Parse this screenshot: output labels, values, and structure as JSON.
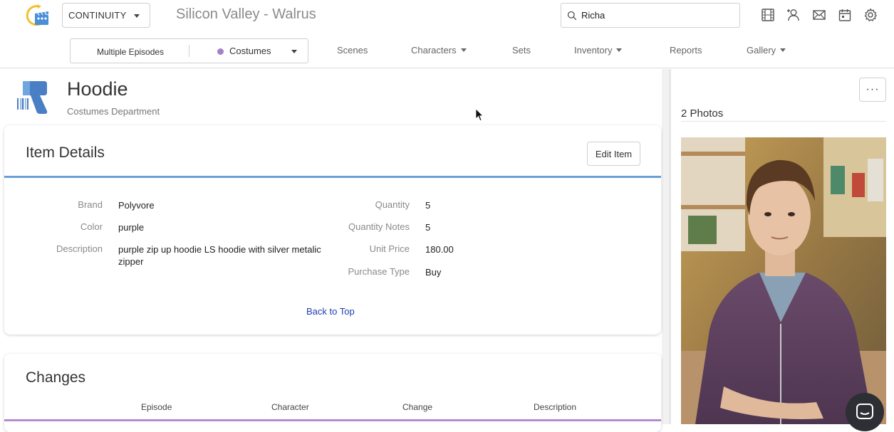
{
  "app": {
    "selector_label": "CONTINUITY",
    "project_title": "Silicon Valley - Walrus"
  },
  "search": {
    "value": "Richa"
  },
  "toolbar_icons": [
    "film-icon",
    "add-user-icon",
    "mail-icon",
    "calendar-icon",
    "settings-icon"
  ],
  "filter": {
    "episodes_label": "Multiple Episodes",
    "department_label": "Costumes",
    "department_color": "#a57fc7"
  },
  "nav": {
    "scenes": "Scenes",
    "characters": "Characters",
    "sets": "Sets",
    "inventory": "Inventory",
    "reports": "Reports",
    "gallery": "Gallery"
  },
  "item": {
    "title": "Hoodie",
    "department": "Costumes Department"
  },
  "details": {
    "title": "Item Details",
    "edit_label": "Edit Item",
    "left_fields": [
      {
        "label": "Brand",
        "value": "Polyvore"
      },
      {
        "label": "Color",
        "value": "purple"
      },
      {
        "label": "Description",
        "value": "purple zip up hoodie LS hoodie with silver metalic zipper"
      }
    ],
    "right_fields": [
      {
        "label": "Quantity",
        "value": "5"
      },
      {
        "label": "Quantity Notes",
        "value": "5"
      },
      {
        "label": "Unit Price",
        "value": "180.00"
      },
      {
        "label": "Purchase Type",
        "value": "Buy"
      }
    ],
    "back_to_top": "Back to Top",
    "accent_color": "#6a9fd6"
  },
  "changes": {
    "title": "Changes",
    "columns": [
      "Episode",
      "Character",
      "Change",
      "Description"
    ],
    "accent_color": "#b68ad0"
  },
  "photos": {
    "count_label": "2 Photos",
    "more_label": "···"
  }
}
